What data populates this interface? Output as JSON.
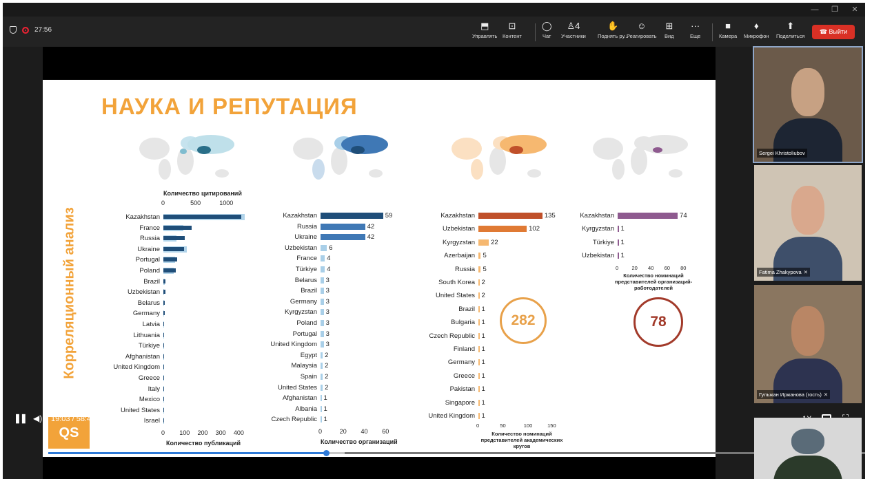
{
  "titlebar": {
    "min": "—",
    "restore": "❐",
    "close": "✕"
  },
  "recording": {
    "time": "27:56"
  },
  "toolbar": [
    {
      "icon": "⬒",
      "label": "Управлять"
    },
    {
      "icon": "⊡",
      "label": "Контент"
    },
    {
      "icon": "◯",
      "label": "Чат"
    },
    {
      "icon": "♙4",
      "label": "Участники"
    },
    {
      "icon": "✋",
      "label": "Поднять ру..."
    },
    {
      "icon": "☺",
      "label": "Реагировать"
    },
    {
      "icon": "⊞",
      "label": "Вид"
    },
    {
      "icon": "···",
      "label": "Еще"
    },
    {
      "icon": "■",
      "label": "Камера"
    },
    {
      "icon": "♦",
      "label": "Микрофон"
    },
    {
      "icon": "⬆",
      "label": "Поделиться"
    }
  ],
  "leave_label": "Выйти",
  "slide": {
    "title": "НАУКА И РЕПУТАЦИЯ",
    "side_label": "Корреляционный анализ",
    "logo": "QS",
    "colors": {
      "accent": "#f2a33a",
      "blue_dark": "#1f4e79",
      "blue_mid": "#3f78b5",
      "blue_light": "#a9cfe8",
      "orange_dark": "#c0502a",
      "orange_mid": "#e07a34",
      "orange_light": "#f6b870",
      "purple": "#8e5a8f",
      "circle_orange": "#e8a14a",
      "circle_red": "#a23a2a"
    }
  },
  "chart_data": [
    {
      "type": "bar",
      "title_top": "Количество цитирований",
      "title_bottom": "Количество публикаций",
      "top_ticks": [
        "0",
        "500",
        "1000"
      ],
      "bottom_ticks": [
        "0",
        "100",
        "200",
        "300",
        "400"
      ],
      "categories": [
        "Kazakhstan",
        "France",
        "Russia",
        "Ukraine",
        "Portugal",
        "Poland",
        "Brazil",
        "Uzbekistan",
        "Belarus",
        "Germany",
        "Latvia",
        "Lithuania",
        "Türkiye",
        "Afghanistan",
        "United Kingdom",
        "Greece",
        "Italy",
        "Mexico",
        "United States",
        "Israel"
      ],
      "series": [
        {
          "name": "Количество публикаций",
          "values": [
            430,
            155,
            120,
            115,
            75,
            70,
            12,
            10,
            8,
            7,
            5,
            4,
            4,
            3,
            3,
            3,
            2,
            2,
            2,
            2
          ]
        },
        {
          "name": "Количество цитирований",
          "values": [
            1400,
            340,
            230,
            400,
            200,
            180,
            20,
            15,
            15,
            10,
            5,
            5,
            5,
            5,
            3,
            3,
            3,
            2,
            2,
            2
          ]
        }
      ],
      "xlim": [
        0,
        450
      ]
    },
    {
      "type": "bar",
      "xlabel": "Количество организаций",
      "ticks": [
        "0",
        "20",
        "40",
        "60"
      ],
      "categories": [
        "Kazakhstan",
        "Russia",
        "Ukraine",
        "Uzbekistan",
        "France",
        "Türkiye",
        "Belarus",
        "Brazil",
        "Germany",
        "Kyrgyzstan",
        "Poland",
        "Portugal",
        "United Kingdom",
        "Egypt",
        "Malaysia",
        "Spain",
        "United States",
        "Afghanistan",
        "Albania",
        "Czech Republic"
      ],
      "values": [
        59,
        42,
        42,
        6,
        4,
        4,
        3,
        3,
        3,
        3,
        3,
        3,
        3,
        2,
        2,
        2,
        2,
        1,
        1,
        1
      ],
      "labels": [
        "59",
        "42",
        "42",
        "6",
        "4",
        "4",
        "3",
        "3",
        "3",
        "3",
        "3",
        "3",
        "3",
        "2",
        "2",
        "2",
        "2",
        "1",
        "1",
        "1"
      ],
      "xlim": [
        0,
        65
      ]
    },
    {
      "type": "bar",
      "xlabel": "Количество номинаций представителей академических кругов",
      "ticks": [
        "0",
        "50",
        "100",
        "150"
      ],
      "categories": [
        "Kazakhstan",
        "Uzbekistan",
        "Kyrgyzstan",
        "Azerbaijan",
        "Russia",
        "South Korea",
        "United States",
        "Brazil",
        "Bulgaria",
        "Czech Republic",
        "Finland",
        "Germany",
        "Greece",
        "Pakistan",
        "Singapore",
        "United Kingdom"
      ],
      "values": [
        135,
        102,
        22,
        5,
        5,
        2,
        2,
        1,
        1,
        1,
        1,
        1,
        1,
        1,
        1,
        1
      ],
      "labels": [
        "135",
        "102",
        "22",
        "5",
        "5",
        "2",
        "2",
        "1",
        "1",
        "1",
        "1",
        "1",
        "1",
        "1",
        "1",
        "1"
      ],
      "xlim": [
        0,
        160
      ],
      "total": "282"
    },
    {
      "type": "bar",
      "xlabel": "Количество номинаций представителей организаций-работодателей",
      "ticks": [
        "0",
        "20",
        "40",
        "60",
        "80"
      ],
      "categories": [
        "Kazakhstan",
        "Kyrgyzstan",
        "Türkiye",
        "Uzbekistan"
      ],
      "values": [
        74,
        1,
        1,
        1
      ],
      "labels": [
        "74",
        "1",
        "1",
        "1"
      ],
      "xlim": [
        0,
        85
      ],
      "total": "78"
    }
  ],
  "player": {
    "play_icon": "❚❚",
    "volume_icon": "◀)",
    "time": "19:03 / 58:47",
    "progress": 0.326,
    "buffered": 0.348,
    "speed": "1X",
    "pip_icon": "",
    "fullscreen_icon": "⛶"
  },
  "participants": [
    {
      "name": "Sergei Khristoliubov",
      "mic_muted": false,
      "colors": [
        "#6b5a4a",
        "#c7a183",
        "#1d2533"
      ]
    },
    {
      "name": "Fatima Zhakypova",
      "mic_muted": true,
      "colors": [
        "#cfc4b4",
        "#d9a88d",
        "#3e4f6a"
      ]
    },
    {
      "name": "Гульжан Иржанова (гость)",
      "mic_muted": true,
      "colors": [
        "#8a7660",
        "#b98665",
        "#2d3350"
      ]
    },
    {
      "name": "",
      "mic_muted": false,
      "colors": [
        "#d8d8d8",
        "#5a6b78",
        "#2b3a2a"
      ]
    }
  ]
}
